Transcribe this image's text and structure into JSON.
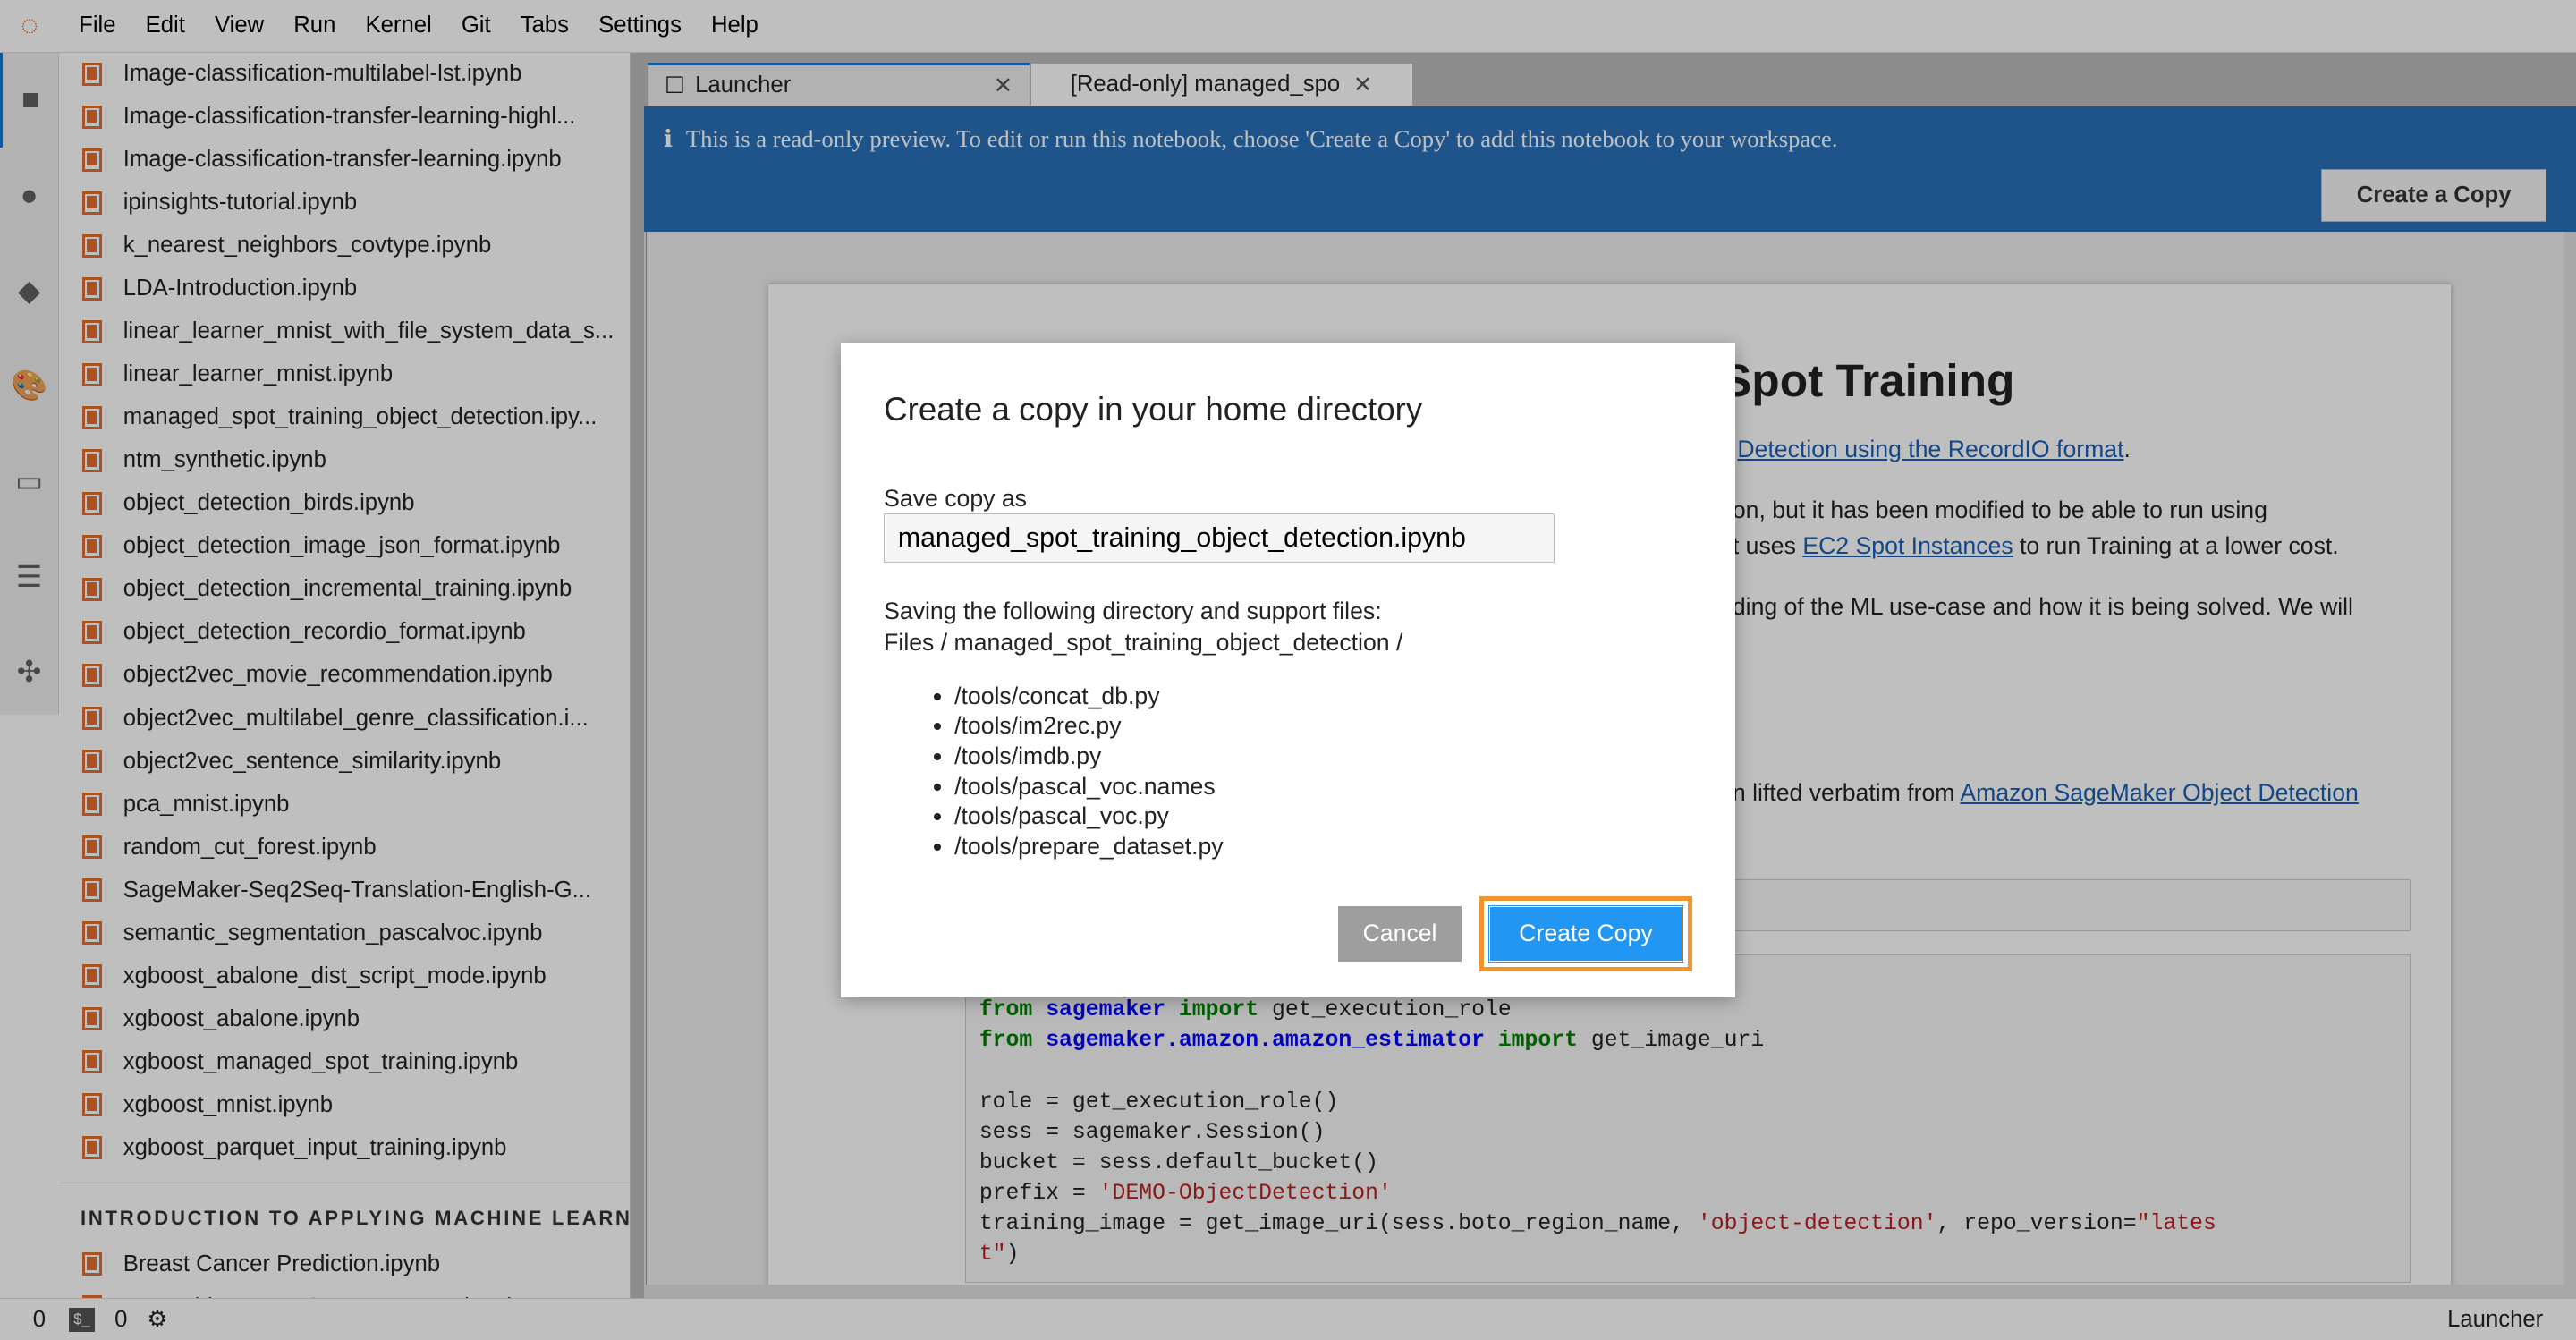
{
  "menubar": {
    "items": [
      "File",
      "Edit",
      "View",
      "Run",
      "Kernel",
      "Git",
      "Tabs",
      "Settings",
      "Help"
    ]
  },
  "iconbar": {
    "icons": [
      "folder-icon",
      "running-icon",
      "git-icon",
      "palette-icon",
      "tabs-icon",
      "toc-icon",
      "extension-icon"
    ]
  },
  "filebrowser": {
    "files": [
      "Image-classification-multilabel-lst.ipynb",
      "Image-classification-transfer-learning-highl...",
      "Image-classification-transfer-learning.ipynb",
      "ipinsights-tutorial.ipynb",
      "k_nearest_neighbors_covtype.ipynb",
      "LDA-Introduction.ipynb",
      "linear_learner_mnist_with_file_system_data_s...",
      "linear_learner_mnist.ipynb",
      "managed_spot_training_object_detection.ipy...",
      "ntm_synthetic.ipynb",
      "object_detection_birds.ipynb",
      "object_detection_image_json_format.ipynb",
      "object_detection_incremental_training.ipynb",
      "object_detection_recordio_format.ipynb",
      "object2vec_movie_recommendation.ipynb",
      "object2vec_multilabel_genre_classification.i...",
      "object2vec_sentence_similarity.ipynb",
      "pca_mnist.ipynb",
      "random_cut_forest.ipynb",
      "SageMaker-Seq2Seq-Translation-English-G...",
      "semantic_segmentation_pascalvoc.ipynb",
      "xgboost_abalone_dist_script_mode.ipynb",
      "xgboost_abalone.ipynb",
      "xgboost_managed_spot_training.ipynb",
      "xgboost_mnist.ipynb",
      "xgboost_parquet_input_training.ipynb"
    ],
    "section": "INTRODUCTION TO APPLYING MACHINE LEARNING",
    "section_files": [
      "Breast Cancer Prediction.ipynb",
      "EnsembleLearnerCensusIncome.ipynb"
    ]
  },
  "tabs": [
    {
      "label": "Launcher",
      "close": "✕"
    },
    {
      "label": "[Read-only] managed_spo",
      "close": "✕"
    }
  ],
  "banner": {
    "message": "This is a read-only preview. To edit or run this notebook, choose 'Create a Copy' to add this notebook to your workspace.",
    "button": "Create a Copy",
    "color": "#2a70b8"
  },
  "notebook": {
    "title_fragment": "Spot Training",
    "p1_link": "Detection using the RecordIO format",
    "p1_after": ".",
    "p2_line1": "on, but it has been modified to be able to run using",
    "p2_line2_before": "t uses ",
    "p2_line2_link": "EC2 Spot Instances",
    "p2_line2_after": " to run Training at a lower cost.",
    "p3": "ding of the ML use-case and how it is being solved. We will",
    "p4_before": "n lifted verbatim from ",
    "p4_link": "Amazon SageMaker Object Detection",
    "code": {
      "l1": [
        "from",
        "sagemaker",
        "import",
        "get_execution_role"
      ],
      "l2": [
        "from",
        "sagemaker.amazon.amazon_estimator",
        "import",
        "get_image_uri"
      ],
      "l3": "role = get_execution_role()",
      "l4": "sess = sagemaker.Session()",
      "l5": "bucket = sess.default_bucket()",
      "l6": [
        "prefix = ",
        "'DEMO-ObjectDetection'"
      ],
      "l7": [
        "training_image = get_image_uri(sess.boto_region_name, ",
        "'object-detection'",
        ", repo_version=",
        "\"lates"
      ],
      "l8": [
        "t\"",
        ")"
      ]
    }
  },
  "dialog": {
    "title": "Create a copy in your home directory",
    "label": "Save copy as",
    "filename": "managed_spot_training_object_detection.ipynb",
    "saving_text": "Saving the following directory and support files:",
    "path": "Files / managed_spot_training_object_detection /",
    "files": [
      "/tools/concat_db.py",
      "/tools/im2rec.py",
      "/tools/imdb.py",
      "/tools/pascal_voc.names",
      "/tools/pascal_voc.py",
      "/tools/prepare_dataset.py"
    ],
    "cancel": "Cancel",
    "create": "Create Copy",
    "accent": "#2196f3",
    "highlight": "#f0952d"
  },
  "statusbar": {
    "count1": "0",
    "count2": "0",
    "right": "Launcher"
  }
}
